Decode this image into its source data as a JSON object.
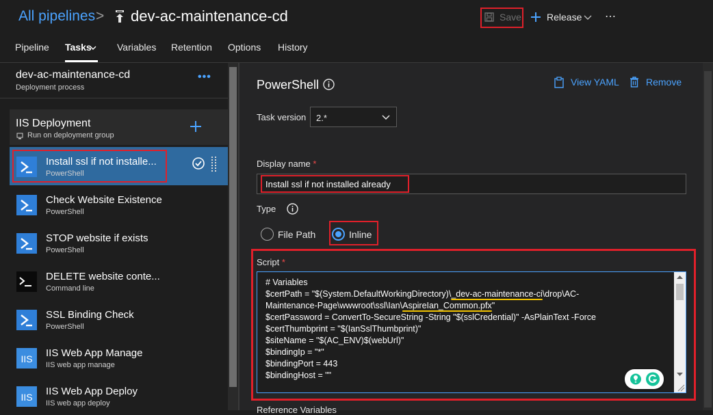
{
  "header": {
    "breadcrumb_root": "All pipelines",
    "breadcrumb_sep": ">",
    "pipeline_name": "dev-ac-maintenance-cd",
    "save_label": "Save",
    "release_label": "Release",
    "more_label": "⋯"
  },
  "tabs": [
    "Pipeline",
    "Tasks",
    "Variables",
    "Retention",
    "Options",
    "History"
  ],
  "active_tab": "Tasks",
  "left_panel": {
    "stage_title": "dev-ac-maintenance-cd",
    "stage_subtitle": "Deployment process",
    "stage_more": "•••",
    "job_title": "IIS Deployment",
    "job_subtitle": "Run on deployment group",
    "tasks": [
      {
        "title": "Install ssl if not installe...",
        "type": "PowerShell",
        "icon": "powershell-icon",
        "selected": true
      },
      {
        "title": "Check Website Existence",
        "type": "PowerShell",
        "icon": "powershell-icon"
      },
      {
        "title": "STOP website if exists",
        "type": "PowerShell",
        "icon": "powershell-icon"
      },
      {
        "title": "DELETE website conte...",
        "type": "Command line",
        "icon": "command-line-icon"
      },
      {
        "title": "SSL Binding Check",
        "type": "PowerShell",
        "icon": "powershell-icon"
      },
      {
        "title": "IIS Web App Manage",
        "type": "IIS web app manage",
        "icon": "iis-icon"
      },
      {
        "title": "IIS Web App Deploy",
        "type": "IIS web app deploy",
        "icon": "iis-icon"
      }
    ]
  },
  "right_panel": {
    "task_title": "PowerShell",
    "view_yaml_label": "View YAML",
    "remove_label": "Remove",
    "task_version_label": "Task version",
    "task_version_value": "2.*",
    "display_name_label": "Display name",
    "display_name_value": "Install ssl if not installed already",
    "type_label": "Type",
    "type_options": [
      "File Path",
      "Inline"
    ],
    "type_selected": "Inline",
    "script_label": "Script",
    "required_mark": "*",
    "script_lines": [
      "# Variables",
      "$certPath = \"$(System.DefaultWorkingDirectory)\\_dev-ac-maintenance-ci\\drop\\AC-",
      "Maintenance-Page\\wwwroot\\ssl\\Ian\\AspireIan_Common.pfx\"",
      "$certPassword = ConvertTo-SecureString -String \"$(sslCredential)\" -AsPlainText -Force",
      "$certThumbprint = \"$(IanSslThumbprint)\"",
      "$siteName = \"$(AC_ENV)$(webUrl)\"",
      "$bindingIp = \"*\"",
      "$bindingPort = 443",
      "$bindingHost = \"\""
    ],
    "bottom_partial_label": "Reference Variables"
  },
  "colors": {
    "accent": "#4ba3ff",
    "highlight_red": "#e0202a",
    "selected_row": "#2f6a9f",
    "underline_yellow": "#f2c300"
  }
}
